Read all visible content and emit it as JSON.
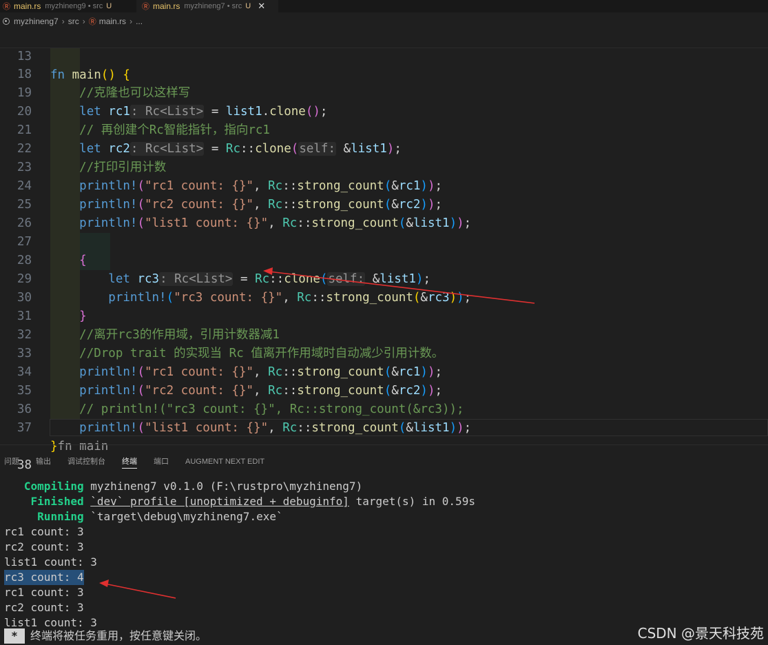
{
  "tabs": [
    {
      "name": "main.rs",
      "path": "myzhineng9 • src",
      "modified": "U"
    },
    {
      "name": "main.rs",
      "path": "myzhineng7 • src",
      "modified": "U"
    }
  ],
  "breadcrumb": {
    "project": "myzhineng7",
    "folder": "src",
    "file": "main.rs",
    "more": "..."
  },
  "editor": {
    "sticky_line": {
      "num": "13",
      "kw": "fn",
      "name": "main"
    },
    "line_numbers": [
      "18",
      "19",
      "20",
      "21",
      "22",
      "23",
      "24",
      "25",
      "26",
      "27",
      "28",
      "29",
      "30",
      "31",
      "32",
      "33",
      "34",
      "35",
      "36",
      "37",
      "38"
    ],
    "comments": {
      "c18": "//克隆也可以这样写",
      "c20": "// 再创建个Rc智能指针，指向rc1",
      "c22": "//打印引用计数",
      "c31": "//离开rc3的作用域，引用计数器减1",
      "c32": "//Drop trait 的实现当 Rc 值离开作用域时自动减少引用计数。",
      "c35": "// println!(\"rc3 count: {}\", Rc::strong_count(&rc3));"
    },
    "strings": {
      "rc1": "\"rc1 count: {}\"",
      "rc2": "\"rc2 count: {}\"",
      "list1": "\"list1 count: {}\"",
      "rc3": "\"rc3 count: {}\""
    },
    "end_hint": "fn main"
  },
  "panel": {
    "tabs": [
      "问题",
      "输出",
      "调试控制台",
      "终端",
      "端口",
      "AUGMENT NEXT EDIT"
    ],
    "active_tab": "终端"
  },
  "terminal": {
    "compiling_label": "Compiling",
    "compiling_text": "myzhineng7 v0.1.0 (F:\\rustpro\\myzhineng7)",
    "finished_label": "Finished",
    "finished_profile": "`dev` profile [unoptimized + debuginfo]",
    "finished_rest": "target(s) in 0.59s",
    "running_label": "Running",
    "running_text": "`target\\debug\\myzhineng7.exe`",
    "output": [
      "rc1 count: 3",
      "rc2 count: 3",
      "list1 count: 3",
      "rc3 count: 4",
      "rc1 count: 3",
      "rc2 count: 3",
      "list1 count: 3"
    ],
    "status_star": "*",
    "status_text": "终端将被任务重用，按任意键关闭。"
  },
  "watermark": "CSDN @景天科技苑",
  "colors": {
    "background": "#1f1f1f",
    "annotation_arrow": "#e03030",
    "selection": "#264f78",
    "terminal_green": "#23d18b"
  }
}
